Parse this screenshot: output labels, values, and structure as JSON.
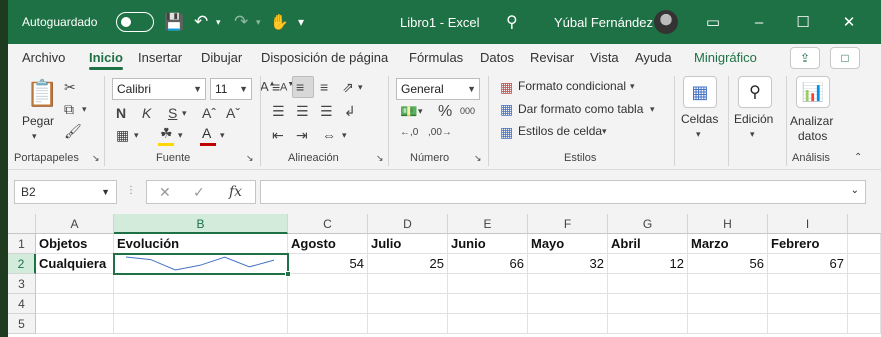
{
  "titlebar": {
    "autosave_label": "Autoguardado",
    "window_title": "Libro1 - Excel",
    "user_name": "Yúbal Fernández"
  },
  "menu": {
    "tabs": [
      "Archivo",
      "Inicio",
      "Insertar",
      "Dibujar",
      "Disposición de página",
      "Fórmulas",
      "Datos",
      "Revisar",
      "Vista",
      "Ayuda",
      "Minigráfico"
    ],
    "active": "Inicio"
  },
  "ribbon": {
    "clipboard": {
      "paste_label": "Pegar",
      "group": "Portapapeles"
    },
    "font": {
      "name": "Calibri",
      "size": "11",
      "group": "Fuente",
      "bold": "N",
      "italic": "K",
      "underline": "S",
      "font_color": "#c00000",
      "fill_color": "#ffd700"
    },
    "alignment": {
      "group": "Alineación"
    },
    "number": {
      "format": "General",
      "group": "Número"
    },
    "styles": {
      "conditional": "Formato condicional",
      "as_table": "Dar formato como tabla",
      "cell_styles": "Estilos de celda",
      "group": "Estilos"
    },
    "cells": {
      "label": "Celdas"
    },
    "editing": {
      "label": "Edición"
    },
    "analysis": {
      "button": [
        "Analizar",
        "datos"
      ],
      "group": "Análisis"
    }
  },
  "formula_bar": {
    "name_box": "B2",
    "fx": "fx",
    "value": ""
  },
  "sheet": {
    "columns": [
      "A",
      "B",
      "C",
      "D",
      "E",
      "F",
      "G",
      "H",
      "I"
    ],
    "selected_column": "B",
    "rows": [
      "1",
      "2",
      "3",
      "4",
      "5"
    ],
    "selected_row": "2",
    "header_row": [
      "Objetos",
      "Evolución",
      "Agosto",
      "Julio",
      "Junio",
      "Mayo",
      "Abril",
      "Marzo",
      "Febrero"
    ],
    "data_row": [
      "Cualquiera",
      "",
      "54",
      "25",
      "66",
      "32",
      "12",
      "56",
      "67"
    ],
    "sparkline": {
      "values": [
        67,
        56,
        12,
        32,
        66,
        25,
        54
      ],
      "color": "#4472c4"
    }
  },
  "colors": {
    "accent": "#1e7145",
    "selection_header": "#d3ebdb"
  }
}
